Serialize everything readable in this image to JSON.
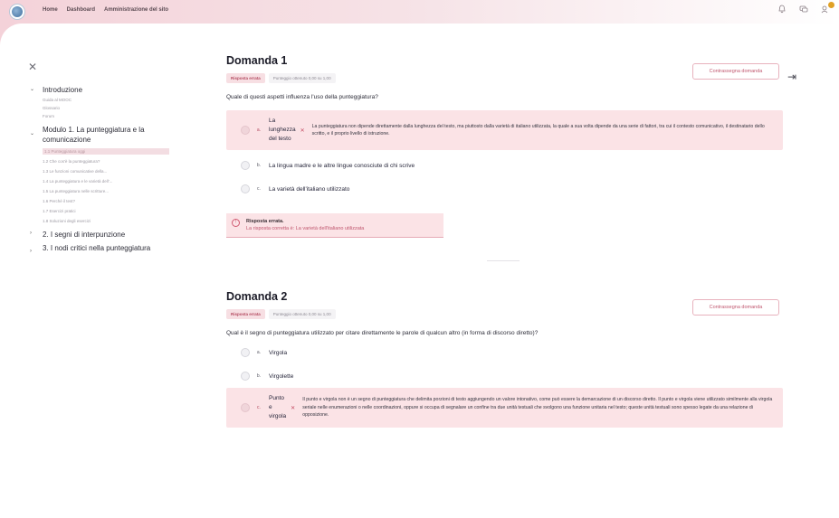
{
  "nav": {
    "home": "Home",
    "dashboard": "Dashboard",
    "site_admin": "Amministrazione del sito"
  },
  "sidebar": {
    "sections": [
      {
        "label": "Introduzione",
        "expanded": true,
        "items": [
          "Guida al MOOC",
          "Glossario",
          "Forum"
        ]
      },
      {
        "label": "Modulo 1. La punteggiatura e la comunicazione",
        "expanded": true,
        "items": [
          "1.1 Punteggiatura oggi",
          "1.2 Che cos'è la punteggiatura?",
          "1.3 Le funzioni comunicative della...",
          "1.4 La punteggiatura e le varietà dell'...",
          "1.5 La punteggiatura nelle scritture...",
          "1.6 Perché il test?",
          "1.7 Esercizi pratici",
          "1.8 Soluzioni degli esercizi"
        ],
        "active_index": 0
      },
      {
        "label": "2. I segni di interpunzione",
        "expanded": false,
        "items": []
      },
      {
        "label": "3. I nodi critici nella punteggiatura",
        "expanded": false,
        "items": []
      }
    ]
  },
  "questions": [
    {
      "title": "Domanda 1",
      "flag_label": "Contrassegna domanda",
      "status": "Risposta errata",
      "score": "Punteggio ottenuto 0,00 su 1,00",
      "text": "Quale di questi aspetti influenza l'uso della punteggiatura?",
      "answers": [
        {
          "letter": "a.",
          "text": "La lunghezza del testo",
          "wrong": true,
          "feedback": "La punteggiatura non dipende direttamente dalla lunghezza del testo, ma piuttosto dalla varietà di italiano utilizzata, la quale a sua volta dipende da una serie di fattori, tra cui il contesto comunicativo, il destinatario dello scritto, e il proprio livello di istruzione."
        },
        {
          "letter": "b.",
          "text": "La lingua madre e le altre lingue conosciute di chi scrive",
          "wrong": false
        },
        {
          "letter": "c.",
          "text": "La varietà dell'italiano utilizzato",
          "wrong": false
        }
      ],
      "result_title": "Risposta errata.",
      "result_text": "La risposta corretta è: La varietà dell'italiano utilizzata"
    },
    {
      "title": "Domanda 2",
      "flag_label": "Contrassegna domanda",
      "status": "Risposta errata",
      "score": "Punteggio ottenuto 0,00 su 1,00",
      "text": "Qual è il segno di punteggiatura utilizzato per citare direttamente le parole di qualcun altro (in forma di discorso diretto)?",
      "answers": [
        {
          "letter": "a.",
          "text": "Virgola",
          "wrong": false
        },
        {
          "letter": "b.",
          "text": "Virgolette",
          "wrong": false
        },
        {
          "letter": "c.",
          "text": "Punto e virgola",
          "wrong": true,
          "feedback": "Il punto e virgola non è un segno di punteggiatura che delimita porzioni di testo aggiungendo un valore intonativo, come può essere la demarcazione di un discorso diretto. Il punto e virgola viene utilizzato similmente alla virgola seriale nelle enumerazioni o nelle coordinazioni, oppure si occupa di segnalare un confine tra due unità testuali che svolgono una funzione unitaria nel testo; queste unità testuali sono spesso legate da una relazione di opposizione."
        }
      ]
    }
  ],
  "colors": {
    "accent": "#c0566e",
    "wrong_bg": "#fbe3e6",
    "topbar": "#f4d2d9"
  }
}
